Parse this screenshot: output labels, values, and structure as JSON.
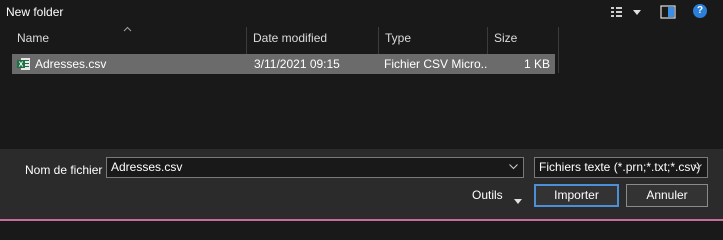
{
  "toolbar": {
    "folder_title": "New folder",
    "icons": [
      "view-options-icon",
      "chevron-down-icon",
      "preview-pane-icon",
      "help-icon"
    ],
    "help_glyph": "?"
  },
  "columns": {
    "name": "Name",
    "date_modified": "Date modified",
    "type": "Type",
    "size": "Size"
  },
  "files": [
    {
      "icon": "excel-csv-icon",
      "name": "Adresses.csv",
      "date_modified": "3/11/2021 09:15",
      "type": "Fichier CSV Micro...",
      "size": "1 KB",
      "selected": true
    }
  ],
  "footer": {
    "filename_label": "Nom de fichier :",
    "filename_value": "Adresses.csv",
    "filetype_value": "Fichiers texte (*.prn;*.txt;*.csv)",
    "tools_label": "Outils",
    "open_label": "Importer",
    "cancel_label": "Annuler"
  },
  "colors": {
    "background": "#191919",
    "selected_row": "#6b6b6b",
    "footer_background": "#2b2b2b",
    "primary_button_border": "#4c8fd6",
    "help_icon": "#2b7fd9",
    "excel_green": "#1d7044"
  }
}
